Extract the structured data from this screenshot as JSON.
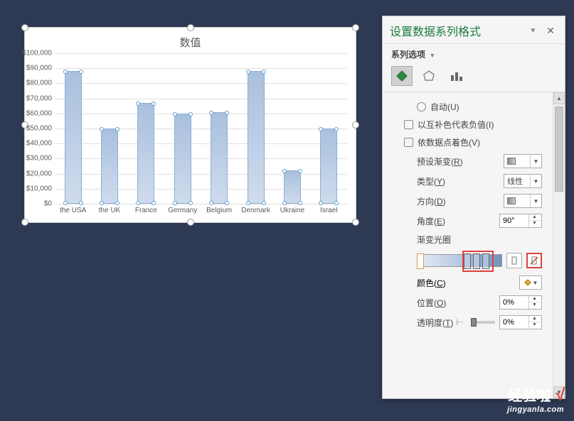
{
  "panel": {
    "title": "设置数据系列格式",
    "sub": "系列选项",
    "tabs": {
      "fill": "fill-effects",
      "outline": "outline",
      "bars": "series-options"
    },
    "fill_section": {
      "auto": "自动(U)",
      "invert_neg": "以互补色代表负值(I)",
      "vary_points": "依数据点着色(V)",
      "preset_gradient": "预设渐变(R)",
      "type": "类型(Y)",
      "type_value": "线性",
      "direction": "方向(D)",
      "angle": "角度(E)",
      "angle_value": "90°",
      "gradient_stops": "渐变光圈",
      "color": "颜色(C)",
      "position": "位置(O)",
      "position_value": "0%",
      "transparency": "透明度(T)",
      "transparency_value": "0%"
    }
  },
  "watermark": {
    "main": "经验啦",
    "url": "jingyanla.com"
  },
  "chart_data": {
    "type": "bar",
    "title": "数值",
    "categories": [
      "the USA",
      "the UK",
      "France",
      "Germany",
      "Belgium",
      "Denmark",
      "Ukraine",
      "Israel"
    ],
    "values": [
      88000,
      50000,
      67000,
      60000,
      61000,
      88000,
      22000,
      50000
    ],
    "ylabel": "",
    "xlabel": "",
    "ylim": [
      0,
      100000
    ],
    "y_ticks": [
      "$0",
      "$10,000",
      "$20,000",
      "$30,000",
      "$40,000",
      "$50,000",
      "$60,000",
      "$70,000",
      "$80,000",
      "$90,000",
      "$100,000"
    ]
  }
}
